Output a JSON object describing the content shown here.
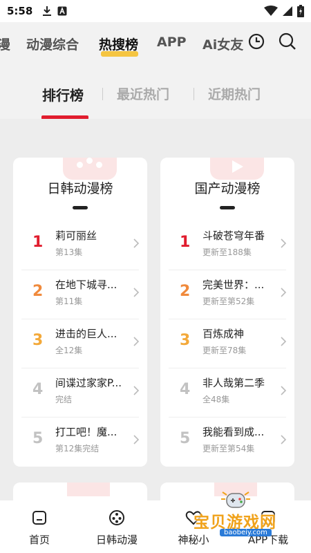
{
  "status_bar": {
    "time": "5:58"
  },
  "category_nav": {
    "items": [
      "漫",
      "动漫综合",
      "热搜榜",
      "APP",
      "Ai女友"
    ],
    "active_index": 2
  },
  "sub_tabs": {
    "items": [
      "排行榜",
      "最近热门",
      "近期热门"
    ],
    "active_index": 0
  },
  "cards": [
    {
      "title": "日韩动漫榜",
      "items": [
        {
          "rank": "1",
          "title": "莉可丽丝",
          "sub": "第13集"
        },
        {
          "rank": "2",
          "title": "在地下城寻...",
          "sub": "第11集"
        },
        {
          "rank": "3",
          "title": "进击的巨人...",
          "sub": "全12集"
        },
        {
          "rank": "4",
          "title": "间谍过家家P...",
          "sub": "完结"
        },
        {
          "rank": "5",
          "title": "打工吧！魔...",
          "sub": "第12集完结"
        }
      ]
    },
    {
      "title": "国产动漫榜",
      "items": [
        {
          "rank": "1",
          "title": "斗破苍穹年番",
          "sub": "更新至188集"
        },
        {
          "rank": "2",
          "title": "完美世界：...",
          "sub": "更新至第52集"
        },
        {
          "rank": "3",
          "title": "百炼成神",
          "sub": "更新至78集"
        },
        {
          "rank": "4",
          "title": "非人哉第二季",
          "sub": "全48集"
        },
        {
          "rank": "5",
          "title": "我能看到成...",
          "sub": "更新至第54集"
        }
      ]
    }
  ],
  "rank_colors": [
    "#e11d2e",
    "#f08a3c",
    "#f3a93a",
    "#c2c2c2",
    "#c2c2c2"
  ],
  "bottom_nav": {
    "items": [
      {
        "label": "首页",
        "icon": "home-icon"
      },
      {
        "label": "日韩动漫",
        "icon": "film-reel-icon"
      },
      {
        "label": "神秘小",
        "icon": "heart-icon"
      },
      {
        "label": "APP下载",
        "icon": "app-icon"
      }
    ]
  },
  "watermark": {
    "text": "宝贝游戏网",
    "url": "baobeiy.com"
  },
  "colors": {
    "accent_red": "#e11d2e",
    "tab_highlight": "#f5c542"
  }
}
